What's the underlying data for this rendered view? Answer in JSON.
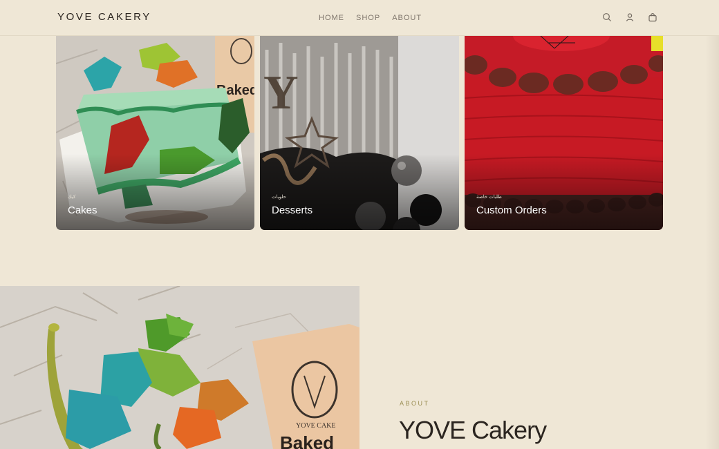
{
  "header": {
    "logo": "YOVE CAKERY",
    "nav": [
      "HOME",
      "SHOP",
      "ABOUT"
    ],
    "icons": [
      "search-icon",
      "user-icon",
      "cart-icon"
    ]
  },
  "categories": [
    {
      "label_ar": "كيك",
      "title": "Cakes"
    },
    {
      "label_ar": "حلويات",
      "title": "Desserts"
    },
    {
      "label_ar": "طلبات خاصة",
      "title": "Custom Orders"
    }
  ],
  "about": {
    "eyebrow": "ABOUT",
    "title": "YOVE Cakery",
    "image_sign_brand": "YOVE CAKE",
    "image_sign_text": "Baked"
  },
  "colors": {
    "background": "#efe7d6",
    "accent": "#9a8e53",
    "text": "#2b2520"
  }
}
